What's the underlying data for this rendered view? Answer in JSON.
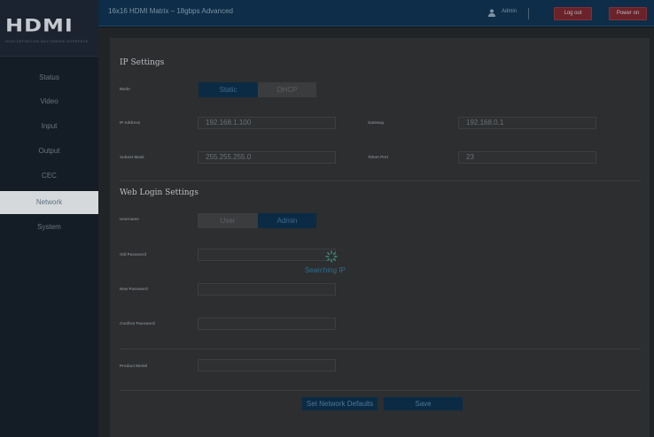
{
  "brand": {
    "logo": "HDMI",
    "logo_tagline": "HIGH-DEFINITION MULTIMEDIA INTERFACE"
  },
  "sidebar": {
    "items": [
      {
        "label": "Status"
      },
      {
        "label": "Video"
      },
      {
        "label": "Input"
      },
      {
        "label": "Output"
      },
      {
        "label": "CEC"
      },
      {
        "label": "Network"
      },
      {
        "label": "System"
      }
    ],
    "active": "Network"
  },
  "header": {
    "title": "16x16 HDMI Matrix – 18gbps Advanced",
    "user": "Admin",
    "logout_label": "Log out",
    "power_label": "Power on"
  },
  "ip_settings": {
    "title": "IP Settings",
    "mode_label": "Mode",
    "mode_options": [
      "Static",
      "DHCP"
    ],
    "mode_selected": "Static",
    "ip_label": "IP Address",
    "ip_value": "192.168.1.100",
    "gateway_label": "Gateway",
    "gateway_value": "192.168.0.1",
    "subnet_label": "Subnet Mask",
    "subnet_value": "255.255.255.0",
    "telnet_label": "Telnet Port",
    "telnet_value": "23"
  },
  "web_login": {
    "title": "Web Login Settings",
    "username_label": "Username",
    "username_options": [
      "User",
      "Admin"
    ],
    "username_selected": "Admin",
    "old_password_label": "Old Password",
    "new_password_label": "New Password",
    "confirm_password_label": "Confirm Password",
    "product_model_label": "Product Model"
  },
  "actions": {
    "defaults_label": "Set Network Defaults",
    "save_label": "Save"
  },
  "loader": {
    "text": "Searching IP"
  },
  "colors": {
    "topbar": "#0d2d48",
    "accent_selected": "#0b2b45",
    "danger_button": "#6c2229",
    "sidebar": "#141c26"
  }
}
